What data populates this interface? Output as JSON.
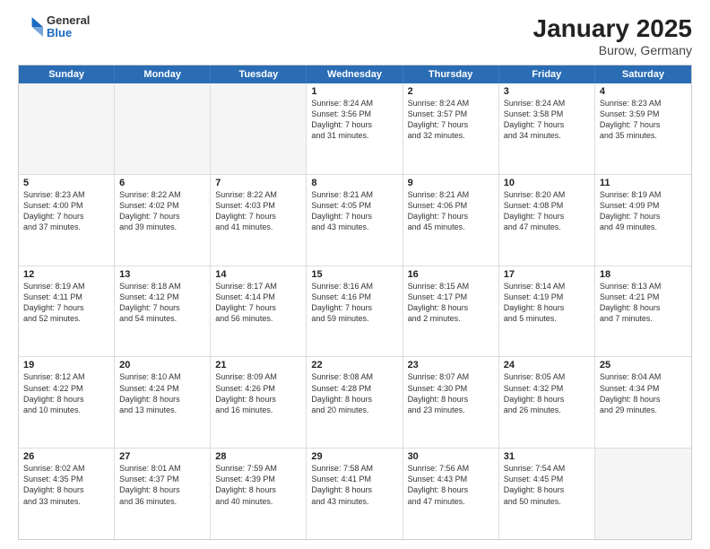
{
  "logo": {
    "general": "General",
    "blue": "Blue"
  },
  "title": "January 2025",
  "subtitle": "Burow, Germany",
  "days": [
    "Sunday",
    "Monday",
    "Tuesday",
    "Wednesday",
    "Thursday",
    "Friday",
    "Saturday"
  ],
  "rows": [
    [
      {
        "day": "",
        "text": ""
      },
      {
        "day": "",
        "text": ""
      },
      {
        "day": "",
        "text": ""
      },
      {
        "day": "1",
        "text": "Sunrise: 8:24 AM\nSunset: 3:56 PM\nDaylight: 7 hours\nand 31 minutes."
      },
      {
        "day": "2",
        "text": "Sunrise: 8:24 AM\nSunset: 3:57 PM\nDaylight: 7 hours\nand 32 minutes."
      },
      {
        "day": "3",
        "text": "Sunrise: 8:24 AM\nSunset: 3:58 PM\nDaylight: 7 hours\nand 34 minutes."
      },
      {
        "day": "4",
        "text": "Sunrise: 8:23 AM\nSunset: 3:59 PM\nDaylight: 7 hours\nand 35 minutes."
      }
    ],
    [
      {
        "day": "5",
        "text": "Sunrise: 8:23 AM\nSunset: 4:00 PM\nDaylight: 7 hours\nand 37 minutes."
      },
      {
        "day": "6",
        "text": "Sunrise: 8:22 AM\nSunset: 4:02 PM\nDaylight: 7 hours\nand 39 minutes."
      },
      {
        "day": "7",
        "text": "Sunrise: 8:22 AM\nSunset: 4:03 PM\nDaylight: 7 hours\nand 41 minutes."
      },
      {
        "day": "8",
        "text": "Sunrise: 8:21 AM\nSunset: 4:05 PM\nDaylight: 7 hours\nand 43 minutes."
      },
      {
        "day": "9",
        "text": "Sunrise: 8:21 AM\nSunset: 4:06 PM\nDaylight: 7 hours\nand 45 minutes."
      },
      {
        "day": "10",
        "text": "Sunrise: 8:20 AM\nSunset: 4:08 PM\nDaylight: 7 hours\nand 47 minutes."
      },
      {
        "day": "11",
        "text": "Sunrise: 8:19 AM\nSunset: 4:09 PM\nDaylight: 7 hours\nand 49 minutes."
      }
    ],
    [
      {
        "day": "12",
        "text": "Sunrise: 8:19 AM\nSunset: 4:11 PM\nDaylight: 7 hours\nand 52 minutes."
      },
      {
        "day": "13",
        "text": "Sunrise: 8:18 AM\nSunset: 4:12 PM\nDaylight: 7 hours\nand 54 minutes."
      },
      {
        "day": "14",
        "text": "Sunrise: 8:17 AM\nSunset: 4:14 PM\nDaylight: 7 hours\nand 56 minutes."
      },
      {
        "day": "15",
        "text": "Sunrise: 8:16 AM\nSunset: 4:16 PM\nDaylight: 7 hours\nand 59 minutes."
      },
      {
        "day": "16",
        "text": "Sunrise: 8:15 AM\nSunset: 4:17 PM\nDaylight: 8 hours\nand 2 minutes."
      },
      {
        "day": "17",
        "text": "Sunrise: 8:14 AM\nSunset: 4:19 PM\nDaylight: 8 hours\nand 5 minutes."
      },
      {
        "day": "18",
        "text": "Sunrise: 8:13 AM\nSunset: 4:21 PM\nDaylight: 8 hours\nand 7 minutes."
      }
    ],
    [
      {
        "day": "19",
        "text": "Sunrise: 8:12 AM\nSunset: 4:22 PM\nDaylight: 8 hours\nand 10 minutes."
      },
      {
        "day": "20",
        "text": "Sunrise: 8:10 AM\nSunset: 4:24 PM\nDaylight: 8 hours\nand 13 minutes."
      },
      {
        "day": "21",
        "text": "Sunrise: 8:09 AM\nSunset: 4:26 PM\nDaylight: 8 hours\nand 16 minutes."
      },
      {
        "day": "22",
        "text": "Sunrise: 8:08 AM\nSunset: 4:28 PM\nDaylight: 8 hours\nand 20 minutes."
      },
      {
        "day": "23",
        "text": "Sunrise: 8:07 AM\nSunset: 4:30 PM\nDaylight: 8 hours\nand 23 minutes."
      },
      {
        "day": "24",
        "text": "Sunrise: 8:05 AM\nSunset: 4:32 PM\nDaylight: 8 hours\nand 26 minutes."
      },
      {
        "day": "25",
        "text": "Sunrise: 8:04 AM\nSunset: 4:34 PM\nDaylight: 8 hours\nand 29 minutes."
      }
    ],
    [
      {
        "day": "26",
        "text": "Sunrise: 8:02 AM\nSunset: 4:35 PM\nDaylight: 8 hours\nand 33 minutes."
      },
      {
        "day": "27",
        "text": "Sunrise: 8:01 AM\nSunset: 4:37 PM\nDaylight: 8 hours\nand 36 minutes."
      },
      {
        "day": "28",
        "text": "Sunrise: 7:59 AM\nSunset: 4:39 PM\nDaylight: 8 hours\nand 40 minutes."
      },
      {
        "day": "29",
        "text": "Sunrise: 7:58 AM\nSunset: 4:41 PM\nDaylight: 8 hours\nand 43 minutes."
      },
      {
        "day": "30",
        "text": "Sunrise: 7:56 AM\nSunset: 4:43 PM\nDaylight: 8 hours\nand 47 minutes."
      },
      {
        "day": "31",
        "text": "Sunrise: 7:54 AM\nSunset: 4:45 PM\nDaylight: 8 hours\nand 50 minutes."
      },
      {
        "day": "",
        "text": ""
      }
    ]
  ]
}
